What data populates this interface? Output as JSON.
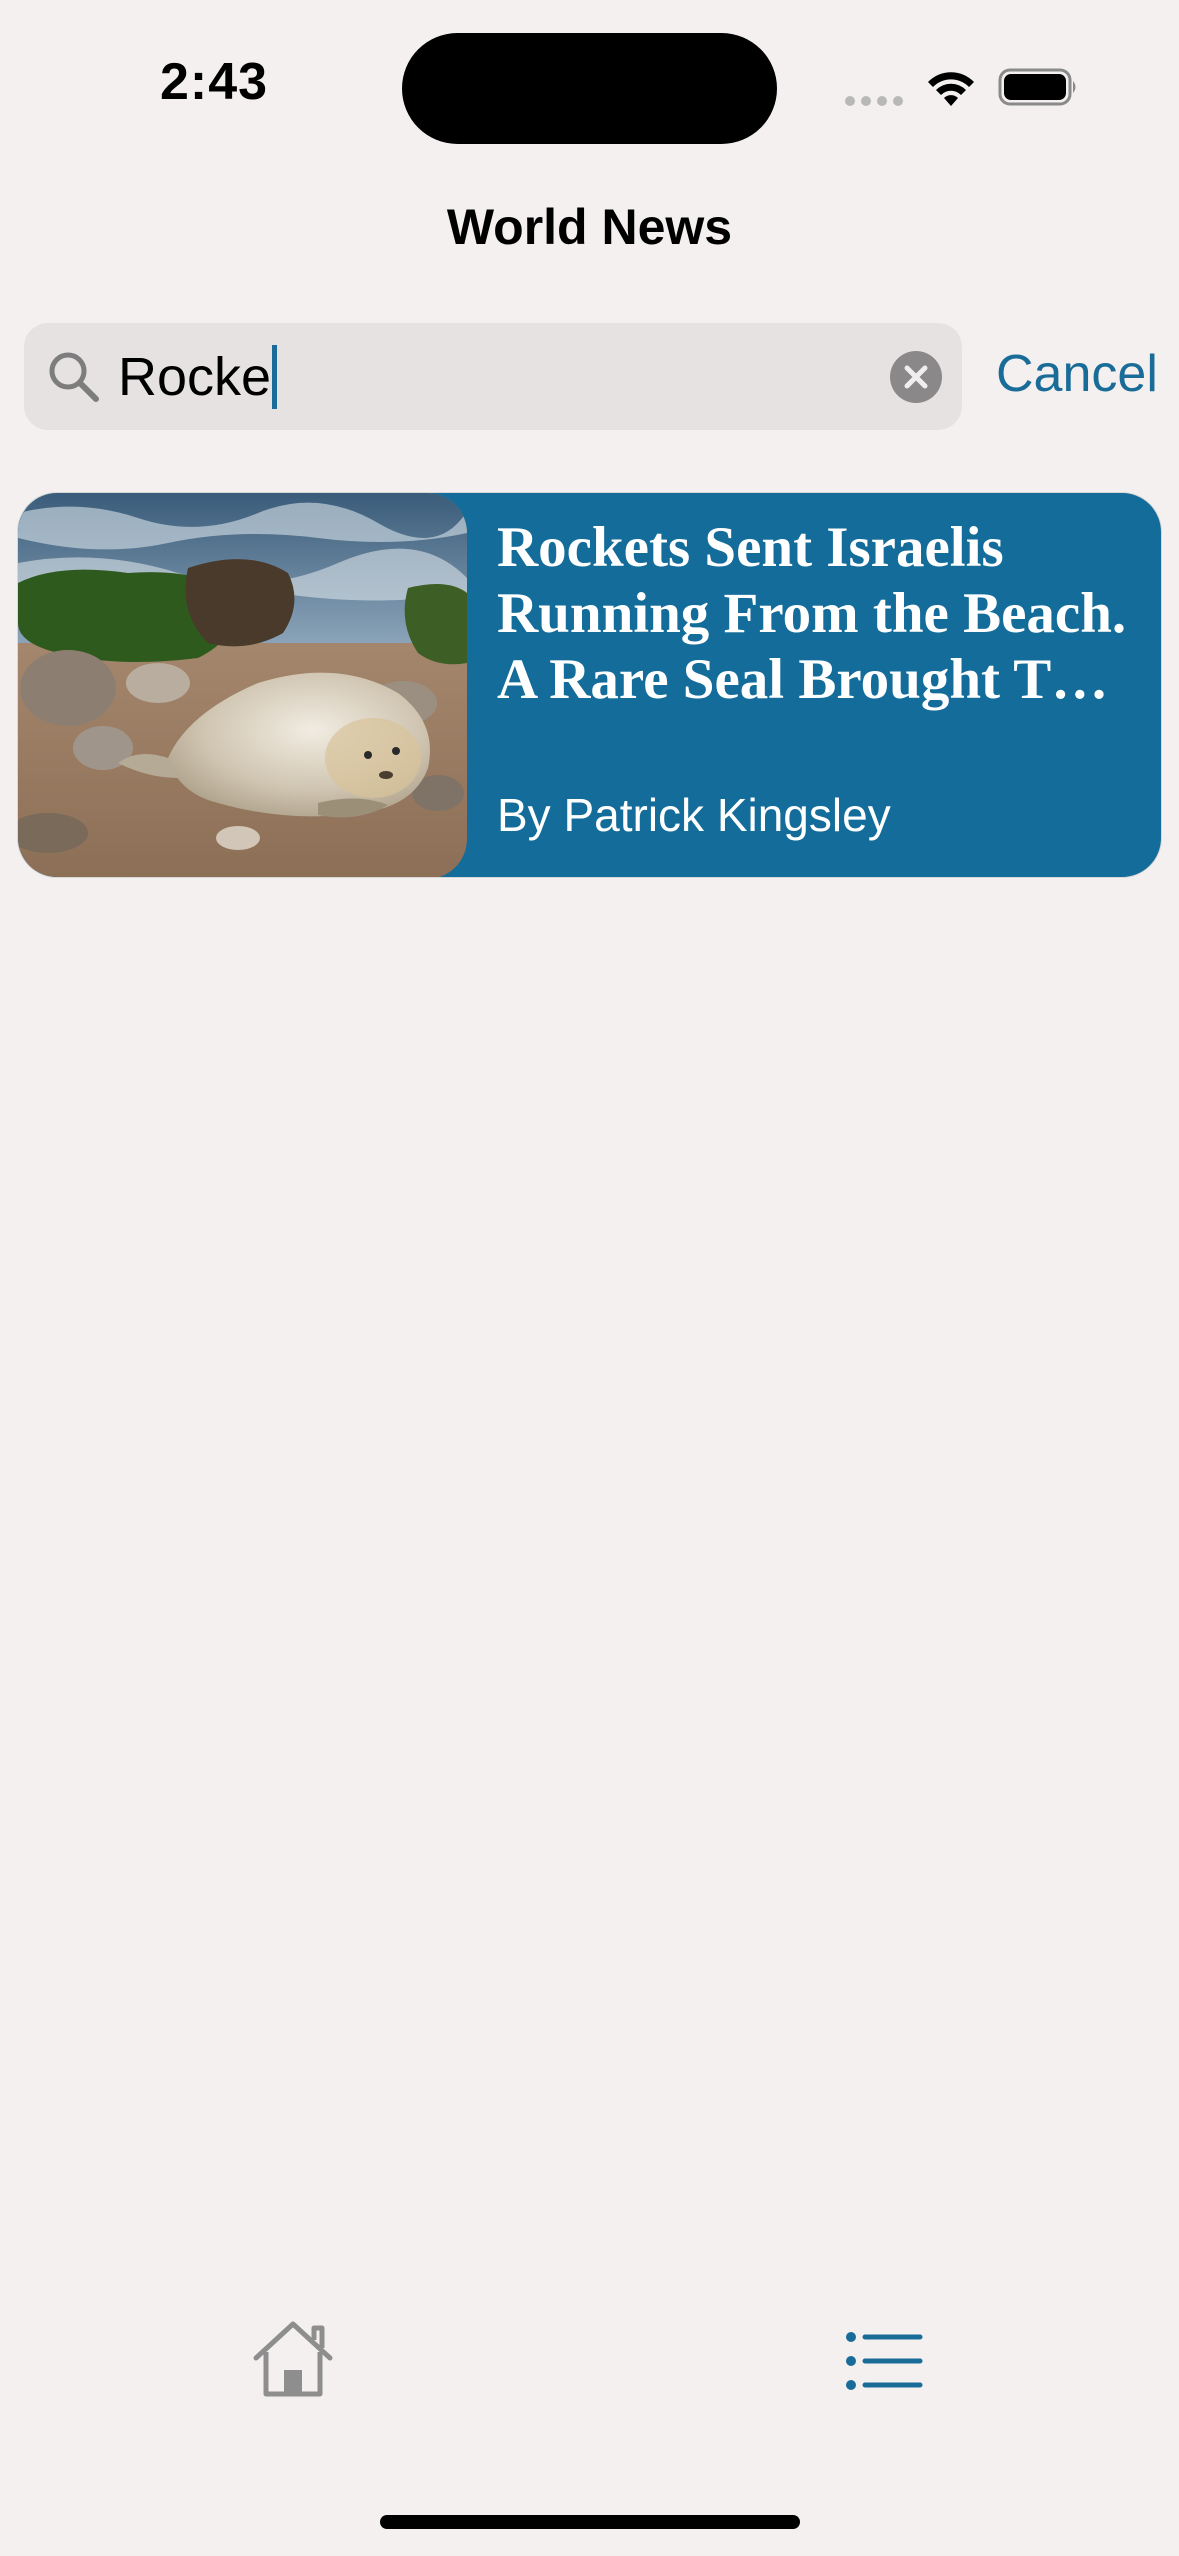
{
  "status_bar": {
    "time": "2:43"
  },
  "nav": {
    "title": "World News"
  },
  "search": {
    "value": "Rocke",
    "cancel_label": "Cancel"
  },
  "results": [
    {
      "title": "Rockets Sent Israelis Running From the Beach. A Rare Seal Brought T…",
      "byline": "By Patrick Kingsley"
    }
  ],
  "tab_bar": {
    "items": [
      {
        "icon": "home-icon",
        "selected": false
      },
      {
        "icon": "list-icon",
        "selected": true
      }
    ]
  },
  "colors": {
    "accent": "#1a6c98",
    "card_background": "#136c99",
    "page_background": "#f4f0ef",
    "search_background": "#e6e2e2",
    "inactive_icon": "#8e8e8e"
  }
}
